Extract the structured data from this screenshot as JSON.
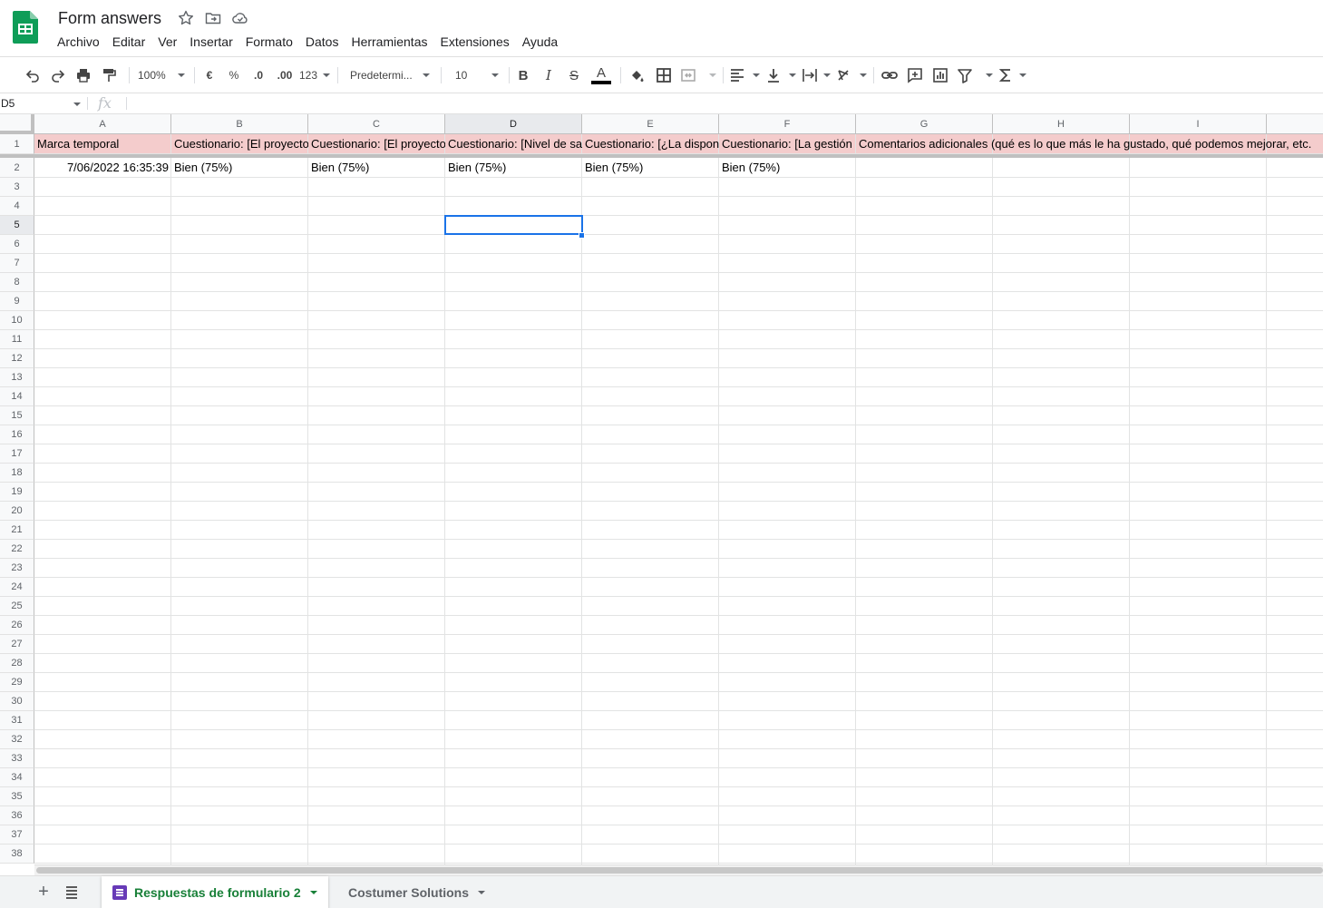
{
  "app": {
    "title": "Form answers",
    "icons": [
      "google-sheets-logo",
      "star-icon",
      "move-folder-icon",
      "cloud-saved-icon"
    ]
  },
  "menu": [
    "Archivo",
    "Editar",
    "Ver",
    "Insertar",
    "Formato",
    "Datos",
    "Herramientas",
    "Extensiones",
    "Ayuda"
  ],
  "toolbar": {
    "zoom": "100%",
    "currency": "€",
    "percent": "%",
    "decrease_decimals": ".0",
    "increase_decimals": ".00",
    "more_formats": "123",
    "font": "Predetermi...",
    "font_size": "10",
    "bold": "B",
    "italic": "I",
    "strikethrough": "S",
    "text_color": "A"
  },
  "formula_bar": {
    "name_box": "D5",
    "fx": "fx",
    "content": ""
  },
  "grid": {
    "columns": [
      "A",
      "B",
      "C",
      "D",
      "E",
      "F",
      "G",
      "H",
      "I"
    ],
    "selected_column": "D",
    "selected_row": 5,
    "selected_cell": "D5",
    "row_numbers": [
      "1",
      "2",
      "3",
      "4",
      "5",
      "6",
      "7",
      "8",
      "9",
      "10",
      "11",
      "12",
      "13",
      "14",
      "15",
      "16",
      "17",
      "18",
      "19",
      "20",
      "21",
      "22",
      "23",
      "24",
      "25",
      "26",
      "27",
      "28",
      "29",
      "30",
      "31",
      "32",
      "33",
      "34",
      "35",
      "36",
      "37",
      "38"
    ],
    "header_row": [
      "Marca temporal",
      "Cuestionario: [El proyecto",
      "Cuestionario: [El proyecto",
      "Cuestionario: [Nivel de sa",
      "Cuestionario: [¿La dispon",
      "Cuestionario: [La gestión",
      "Comentarios adicionales (qué es lo que más le ha gustado, qué podemos mejorar, etc."
    ],
    "data_rows": [
      [
        "7/06/2022 16:35:39",
        "Bien (75%)",
        "Bien (75%)",
        "Bien (75%)",
        "Bien (75%)",
        "Bien (75%)",
        ""
      ]
    ],
    "header_row_color": "#f4cccc"
  },
  "sheets": {
    "add_label": "+",
    "tabs": [
      {
        "label": "Respuestas de formulario 2",
        "active": true
      },
      {
        "label": "Costumer Solutions",
        "active": false
      }
    ]
  },
  "colors": {
    "accent": "#1a73e8",
    "sheets_green": "#188038",
    "form_purple": "#673ab7",
    "logo_green": "#0f9d58"
  }
}
